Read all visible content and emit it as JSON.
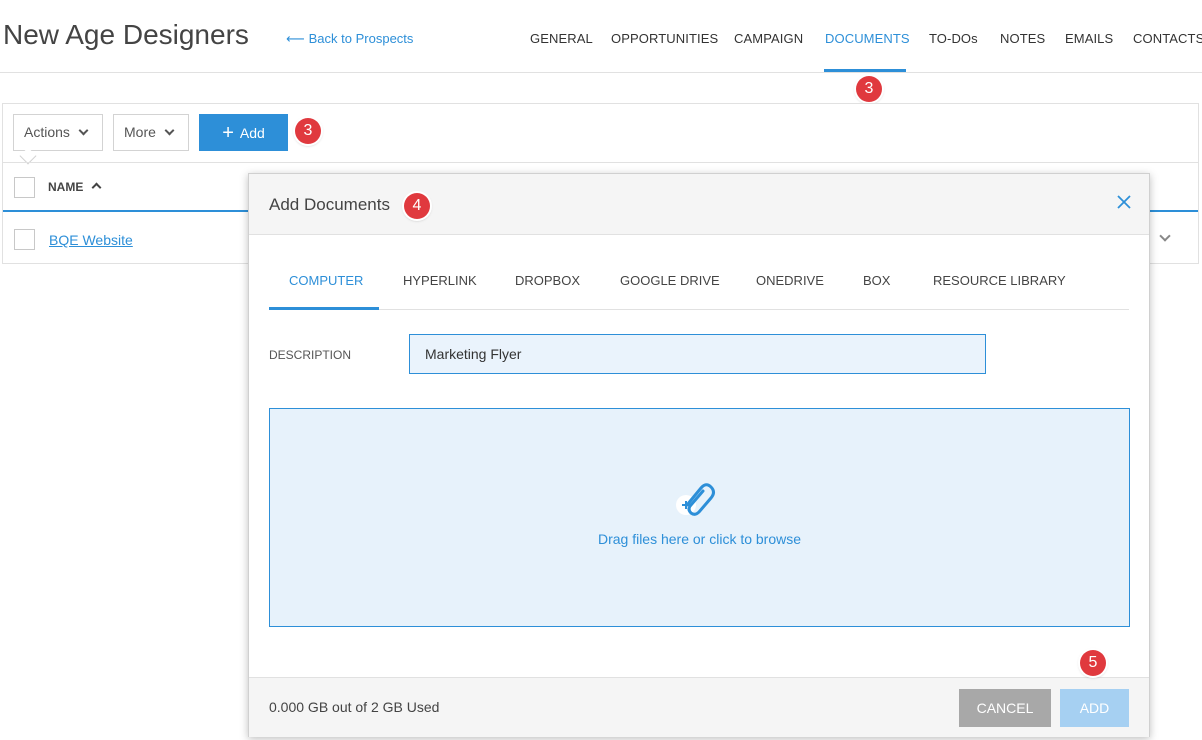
{
  "header": {
    "title": "New Age Designers",
    "back_link": "Back to Prospects",
    "tabs": [
      {
        "label": "GENERAL",
        "active": false
      },
      {
        "label": "OPPORTUNITIES",
        "active": false
      },
      {
        "label": "CAMPAIGN",
        "active": false
      },
      {
        "label": "DOCUMENTS",
        "active": true
      },
      {
        "label": "TO-DOs",
        "active": false
      },
      {
        "label": "NOTES",
        "active": false
      },
      {
        "label": "EMAILS",
        "active": false
      },
      {
        "label": "CONTACTS",
        "active": false
      }
    ]
  },
  "toolbar": {
    "actions_label": "Actions",
    "more_label": "More",
    "add_label": "Add"
  },
  "table": {
    "column_name": "NAME",
    "rows": [
      {
        "name": "BQE Website"
      }
    ]
  },
  "modal": {
    "title": "Add Documents",
    "source_tabs": [
      {
        "label": "COMPUTER",
        "active": true
      },
      {
        "label": "HYPERLINK",
        "active": false
      },
      {
        "label": "DROPBOX",
        "active": false
      },
      {
        "label": "GOOGLE DRIVE",
        "active": false
      },
      {
        "label": "ONEDRIVE",
        "active": false
      },
      {
        "label": "BOX",
        "active": false
      },
      {
        "label": "RESOURCE LIBRARY",
        "active": false
      }
    ],
    "description_label": "DESCRIPTION",
    "description_value": "Marketing Flyer",
    "dropzone_text": "Drag files here or click to browse",
    "storage_text": "0.000 GB out of 2 GB Used",
    "cancel_label": "CANCEL",
    "add_label": "ADD"
  },
  "badges": {
    "documents_tab": "3",
    "add_button": "3",
    "modal_title": "4",
    "add_doc_button": "5"
  },
  "colors": {
    "accent": "#2d8fd8",
    "badge": "#e0393e",
    "dropzone_bg": "#e7f2fb",
    "cancel_bg": "#a8a8a8",
    "add_disabled_bg": "#a6d0f2"
  },
  "icons": {
    "back": "arrow-left-icon",
    "close": "close-icon",
    "clip": "paperclip-icon",
    "sort": "sort-ascending-icon"
  }
}
